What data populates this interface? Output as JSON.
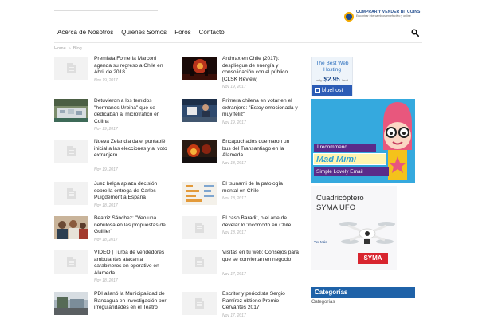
{
  "header": {
    "ad_title": "COMPRAR Y VENDER BITCOINS",
    "ad_subtitle": "Encontrar intercambios en efectivo y online"
  },
  "nav": {
    "items": [
      "Acerca de Nosotros",
      "Quienes Somos",
      "Foros",
      "Contacto"
    ],
    "search_icon": "search-icon"
  },
  "breadcrumb": {
    "home": "Home",
    "separator": "»",
    "current": "Blog"
  },
  "articles_left": [
    {
      "title": "Premiata Forneria Marconi agenda su regreso a Chile en Abril de 2018",
      "date": "Nov 19, 2017",
      "thumb": "placeholder"
    },
    {
      "title": "Detuvieron a los temidos \"hermanos Urbina\" que se dedicaban al microtráfico en Colina",
      "date": "Nov 19, 2017",
      "thumb": "photo-table"
    },
    {
      "title": "Nueva Zelandia da el puntapié inicial a las elecciones y al voto extranjero",
      "date": "Nov 19, 2017",
      "thumb": "placeholder"
    },
    {
      "title": "Juez belga aplaza decisión sobre la entrega de Carles Puigdemont a España",
      "date": "Nov 18, 2017",
      "thumb": "placeholder"
    },
    {
      "title": "Beatriz Sánchez: \"Veo una nebulosa en las propuestas de Guillier\"",
      "date": "Nov 18, 2017",
      "thumb": "photo-people"
    },
    {
      "title": "VIDEO | Turba de vendedores ambulantes atacan a carabineros en operativo en Alameda",
      "date": "Nov 18, 2017",
      "thumb": "placeholder"
    },
    {
      "title": "PDI allanó la Municipalidad de Rancagua en investigación por irregularidades en el Teatro",
      "date": "",
      "thumb": "photo-street"
    }
  ],
  "articles_right": [
    {
      "title": "Anthrax en Chile (2017): despliegue de energía y consolidación con el público [CLSK Review]",
      "date": "Nov 19, 2017",
      "thumb": "photo-concert"
    },
    {
      "title": "Primera chilena en votar en el extranjero: \"Estoy emocionada y muy feliz\"",
      "date": "Nov 19, 2017",
      "thumb": "photo-voter"
    },
    {
      "title": "Encapuchados quemaron un bus del Transantiago en la Alameda",
      "date": "Nov 18, 2017",
      "thumb": "photo-fire"
    },
    {
      "title": "El tsunami de la patología mental en Chile",
      "date": "Nov 18, 2017",
      "thumb": "photo-chart"
    },
    {
      "title": "El caso Baradit, o el arte de develar lo 'incómodo en Chile",
      "date": "Nov 18, 2017",
      "thumb": "placeholder"
    },
    {
      "title": "Visitas en tu web: Consejos para que se conviertan en negocio",
      "date": "Nov 17, 2017",
      "thumb": "placeholder"
    },
    {
      "title": "Escritor y periodista Sergio Ramírez obtiene Premio Cervantes 2017",
      "date": "Nov 17, 2017",
      "thumb": "placeholder"
    }
  ],
  "sidebar": {
    "hosting_ad": {
      "title": "The Best Web Hosting",
      "price_prefix": "only",
      "price": "$2.95",
      "price_suffix": "/mo*",
      "brand": "bluehost"
    },
    "madmimi_ad": {
      "line1": "I recommend",
      "name": "Mad Mimi",
      "tagline": "Simple Lovely Email"
    },
    "drone_ad": {
      "line1": "Cuadricóptero",
      "line2": "SYMA UFO",
      "cta": "Ver Más",
      "brand": "SYMA"
    },
    "categories": {
      "header": "Categorías",
      "select_value": "Categorías"
    }
  },
  "colors": {
    "accent_blue": "#1f62a8",
    "bitcoin_orange": "#f2a900",
    "madmimi_sky": "#35a9de",
    "syma_red": "#d8252f"
  }
}
